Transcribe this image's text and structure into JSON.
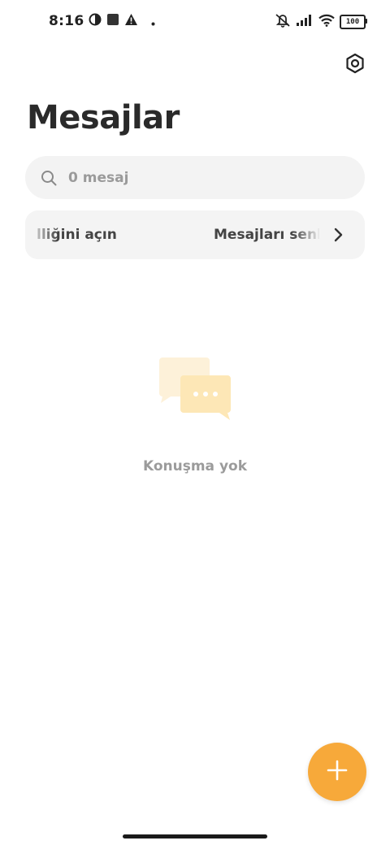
{
  "status_bar": {
    "time": "8:16",
    "battery": "100",
    "icons": [
      "data-saver-icon",
      "square-notification-icon",
      "warning-icon",
      "dot-icon",
      "mute-icon",
      "signal-icon",
      "wifi-icon",
      "battery-icon"
    ]
  },
  "header": {
    "title": "Mesajlar",
    "settings_icon": "settings-hexagon-icon"
  },
  "search": {
    "placeholder": "0 mesaj",
    "value": ""
  },
  "sync_banner": {
    "text_left": "lliğini açın",
    "text_right": "Mesajları senk",
    "chevron_icon": "chevron-right-icon"
  },
  "empty_state": {
    "illustration_icon": "chat-bubbles-icon",
    "message": "Konuşma yok"
  },
  "fab": {
    "icon": "plus-icon",
    "color": "#f7a93a"
  }
}
